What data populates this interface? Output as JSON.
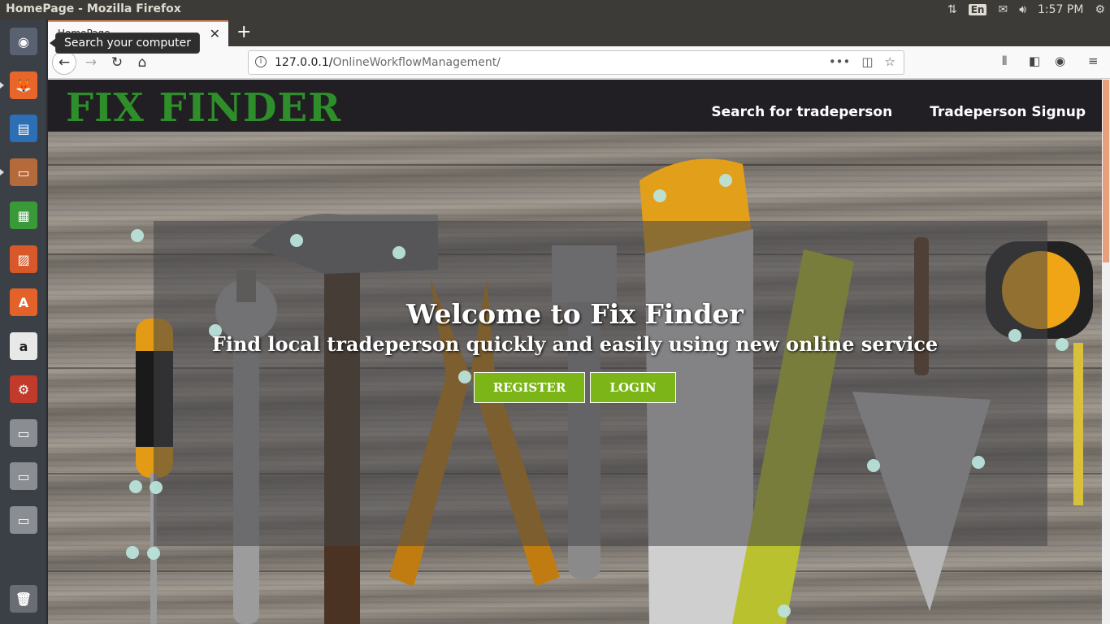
{
  "os": {
    "window_title": "HomePage - Mozilla Firefox",
    "keyboard_layout": "En",
    "clock": "1:57 PM",
    "tooltip": "Search your computer"
  },
  "launcher": {
    "items": [
      {
        "name": "ubuntu-dash",
        "glyph": "◉"
      },
      {
        "name": "firefox",
        "glyph": "🦊"
      },
      {
        "name": "image-viewer",
        "glyph": "▤"
      },
      {
        "name": "files",
        "glyph": "▭"
      },
      {
        "name": "calc",
        "glyph": "▦"
      },
      {
        "name": "impress",
        "glyph": "▨"
      },
      {
        "name": "software-center",
        "glyph": "A"
      },
      {
        "name": "amazon",
        "glyph": "a"
      },
      {
        "name": "system-settings",
        "glyph": "⚙"
      },
      {
        "name": "drive-1",
        "glyph": "▭"
      },
      {
        "name": "drive-2",
        "glyph": "▭"
      },
      {
        "name": "drive-3",
        "glyph": "▭"
      },
      {
        "name": "trash",
        "glyph": "🗑"
      }
    ]
  },
  "browser": {
    "tab_title": "HomePage",
    "url_host": "127.0.0.1/",
    "url_path": "OnlineWorkflowManagement/"
  },
  "site": {
    "logo": "FIX FINDER",
    "nav": [
      "Search for tradeperson",
      "Tradeperson Signup"
    ],
    "hero": {
      "heading": "Welcome to Fix Finder",
      "tagline": "Find local tradeperson quickly and easily using new online service",
      "register_label": "REGISTER",
      "login_label": "LOGIN"
    }
  },
  "colors": {
    "logo_green": "#2e8f2a",
    "button_green": "#7cb518",
    "header_bg": "#221f24"
  }
}
